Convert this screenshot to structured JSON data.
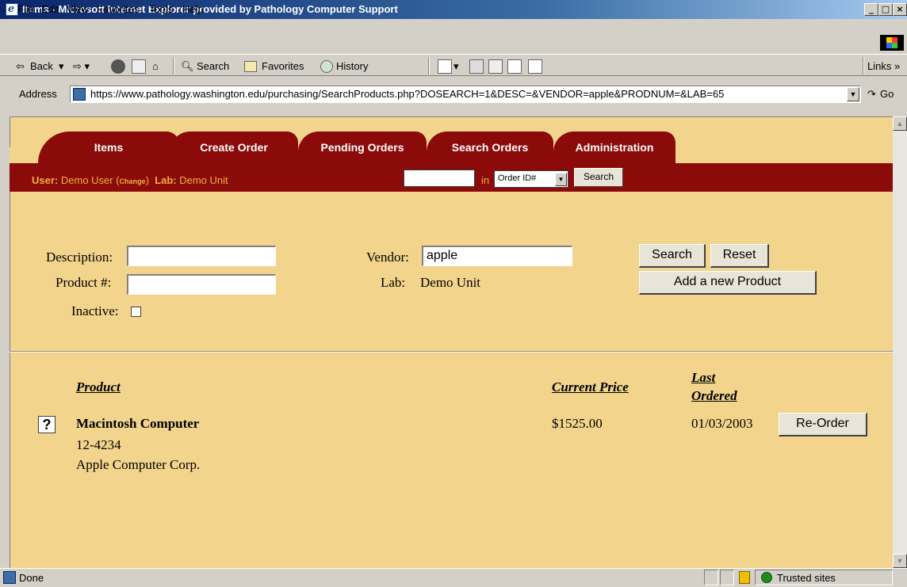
{
  "window": {
    "title": "Items - Microsoft Internet Explorer provided by Pathology Computer Support",
    "min": "_",
    "max": "□",
    "close": "×"
  },
  "menu": {
    "file": "File",
    "edit": "Edit",
    "view": "View",
    "favorites": "Favorites",
    "tools": "Tools",
    "help": "Help"
  },
  "toolbar": {
    "back": "Back",
    "search": "Search",
    "favorites": "Favorites",
    "history": "History",
    "links": "Links »"
  },
  "address": {
    "label": "Address",
    "url": "https://www.pathology.washington.edu/purchasing/SearchProducts.php?DOSEARCH=1&DESC=&VENDOR=apple&PRODNUM=&LAB=65",
    "go": "Go"
  },
  "tabs": [
    "Items",
    "Create Order",
    "Pending Orders",
    "Search Orders",
    "Administration"
  ],
  "userbar": {
    "user_label": "User:",
    "user_name": "Demo User (",
    "change": "Change",
    "close_paren": ")",
    "lab_label": "Lab:",
    "lab_name": "Demo Unit",
    "in_label": "in",
    "select_value": "Order ID#",
    "search": "Search"
  },
  "form": {
    "description_label": "Description:",
    "description_value": "",
    "product_label": "Product #:",
    "product_value": "",
    "inactive_label": "Inactive:",
    "vendor_label": "Vendor:",
    "vendor_value": "apple",
    "lab_label": "Lab:",
    "lab_value": "Demo Unit",
    "search_btn": "Search",
    "reset_btn": "Reset",
    "add_btn": "Add a new Product"
  },
  "results": {
    "headers": {
      "product": "Product",
      "price": "Current Price",
      "last_line1": "Last",
      "last_line2": "Ordered"
    },
    "rows": [
      {
        "name": "Macintosh Computer",
        "number": "12-4234",
        "vendor": "Apple Computer Corp.",
        "price": "$1525.00",
        "last_ordered": "01/03/2003",
        "action": "Re-Order",
        "info": "?"
      }
    ]
  },
  "status": {
    "text": "Done",
    "zone": "Trusted sites"
  },
  "colors": {
    "content_bg": "#f2d48c",
    "tab_red": "#8b0a0a",
    "userbar_text": "#f2b23a"
  }
}
